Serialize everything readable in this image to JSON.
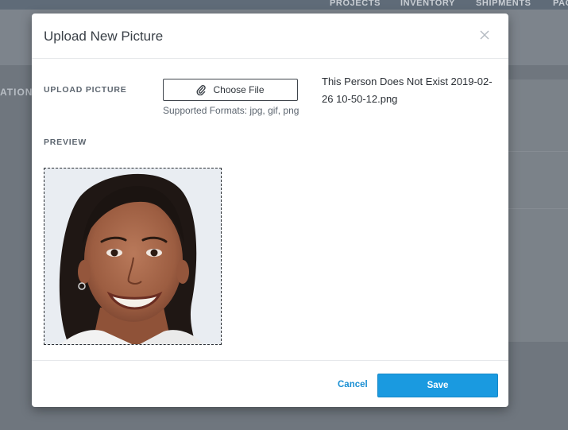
{
  "background": {
    "nav_items": [
      "PROJECTS",
      "INVENTORY",
      "SHIPMENTS",
      "PAC"
    ],
    "left_fragment": "ATION"
  },
  "modal": {
    "title": "Upload New Picture",
    "close_icon": "close-icon",
    "upload_label": "UPLOAD PICTURE",
    "choose_file_label": "Choose File",
    "choose_file_icon": "paperclip-icon",
    "supported_formats": "Supported Formats: jpg, gif, png",
    "selected_filename": "This Person Does Not Exist 2019-02-26 10-50-12.png",
    "preview_label": "PREVIEW",
    "preview_alt": "portrait-photo",
    "cancel_label": "Cancel",
    "save_label": "Save"
  },
  "colors": {
    "accent": "#1a9ae0",
    "link": "#1a8fd3",
    "overlay": "#747b84"
  }
}
